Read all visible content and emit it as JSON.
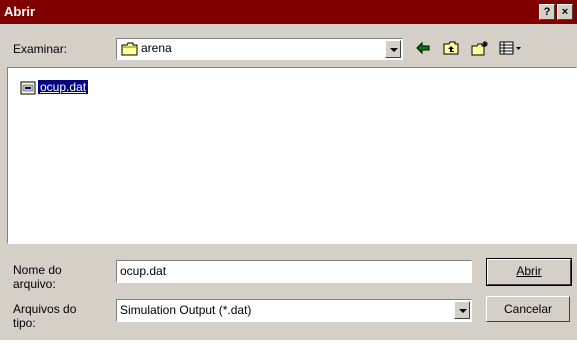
{
  "window": {
    "title": "Abrir",
    "help_glyph": "?",
    "close_glyph": "×"
  },
  "lookin": {
    "label": "Examinar:",
    "value": "arena",
    "icon": "folder-icon"
  },
  "toolbar": {
    "icons": [
      "back-arrow-icon",
      "up-one-level-icon",
      "new-folder-icon",
      "view-menu-icon"
    ]
  },
  "files": [
    {
      "name": "ocup.dat",
      "icon": "file-icon",
      "selected": true
    }
  ],
  "filename": {
    "label_line1": "Nome do",
    "label_line2": "arquivo:",
    "value": "ocup.dat"
  },
  "filetype": {
    "label_line1": "Arquivos do",
    "label_line2": "tipo:",
    "value": "Simulation Output (*.dat)"
  },
  "buttons": {
    "open": "Abrir",
    "cancel": "Cancelar"
  },
  "colors": {
    "titlebar": "#800000",
    "face": "#d4d0c8",
    "selection": "#000080"
  }
}
